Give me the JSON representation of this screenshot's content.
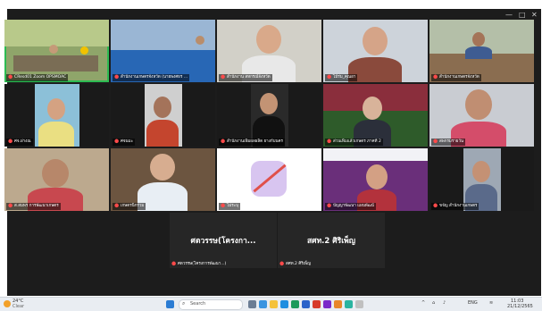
{
  "window": {
    "controls": [
      "—",
      "□",
      "✕"
    ]
  },
  "tiles": [
    {
      "label": "CResd01 Zoom OPSMOAC",
      "active": true
    },
    {
      "label": "สำนักงานเกษตรจังหวัด (นายพงศธร ...",
      "active": false
    },
    {
      "label": "สำนักงาน สหกรณ์จังหวัด",
      "active": false
    },
    {
      "label": "ไม้ร่ม_คุณอา",
      "active": false
    },
    {
      "label": "สำนักงานเกษตรจังหวัด",
      "active": false
    },
    {
      "label": "ศจ.ฝางณ",
      "active": false
    },
    {
      "label": "ศจนมะ",
      "active": false
    },
    {
      "label": "สำนักงานเพิ่มผลผลิต ยางกับนคร",
      "active": false
    },
    {
      "label": "ส่วนเพิ่มแล้วเกษตร ภาคที่ 2",
      "active": false
    },
    {
      "label": "สพกรมรายวัน",
      "active": false
    },
    {
      "label": "ส.สมพร การพัฒนาเกษตร",
      "active": false
    },
    {
      "label": "เกษตรนิกร่วม",
      "active": false
    },
    {
      "label": "ไม่ระบุ",
      "active": false
    },
    {
      "label": "ปัญญาพัฒนา แผนพัฒน์",
      "active": false
    },
    {
      "label": "ขจัญ สำนักงานเกษตร",
      "active": false
    }
  ],
  "big_tiles": [
    {
      "name": "ศตวรรษ(โครงกา...",
      "label": "ศตวรรษ(โครงการพัฒนา...)"
    },
    {
      "name": "สศท.2 ศิริเพ็ญ",
      "label": "สศท.2 ศิริเพ็ญ"
    }
  ],
  "taskbar": {
    "weather_temp": "24°C",
    "weather_desc": "Clear",
    "search_placeholder": "Search",
    "lang": "ENG",
    "time": "11:03",
    "date": "21/12/2565"
  }
}
